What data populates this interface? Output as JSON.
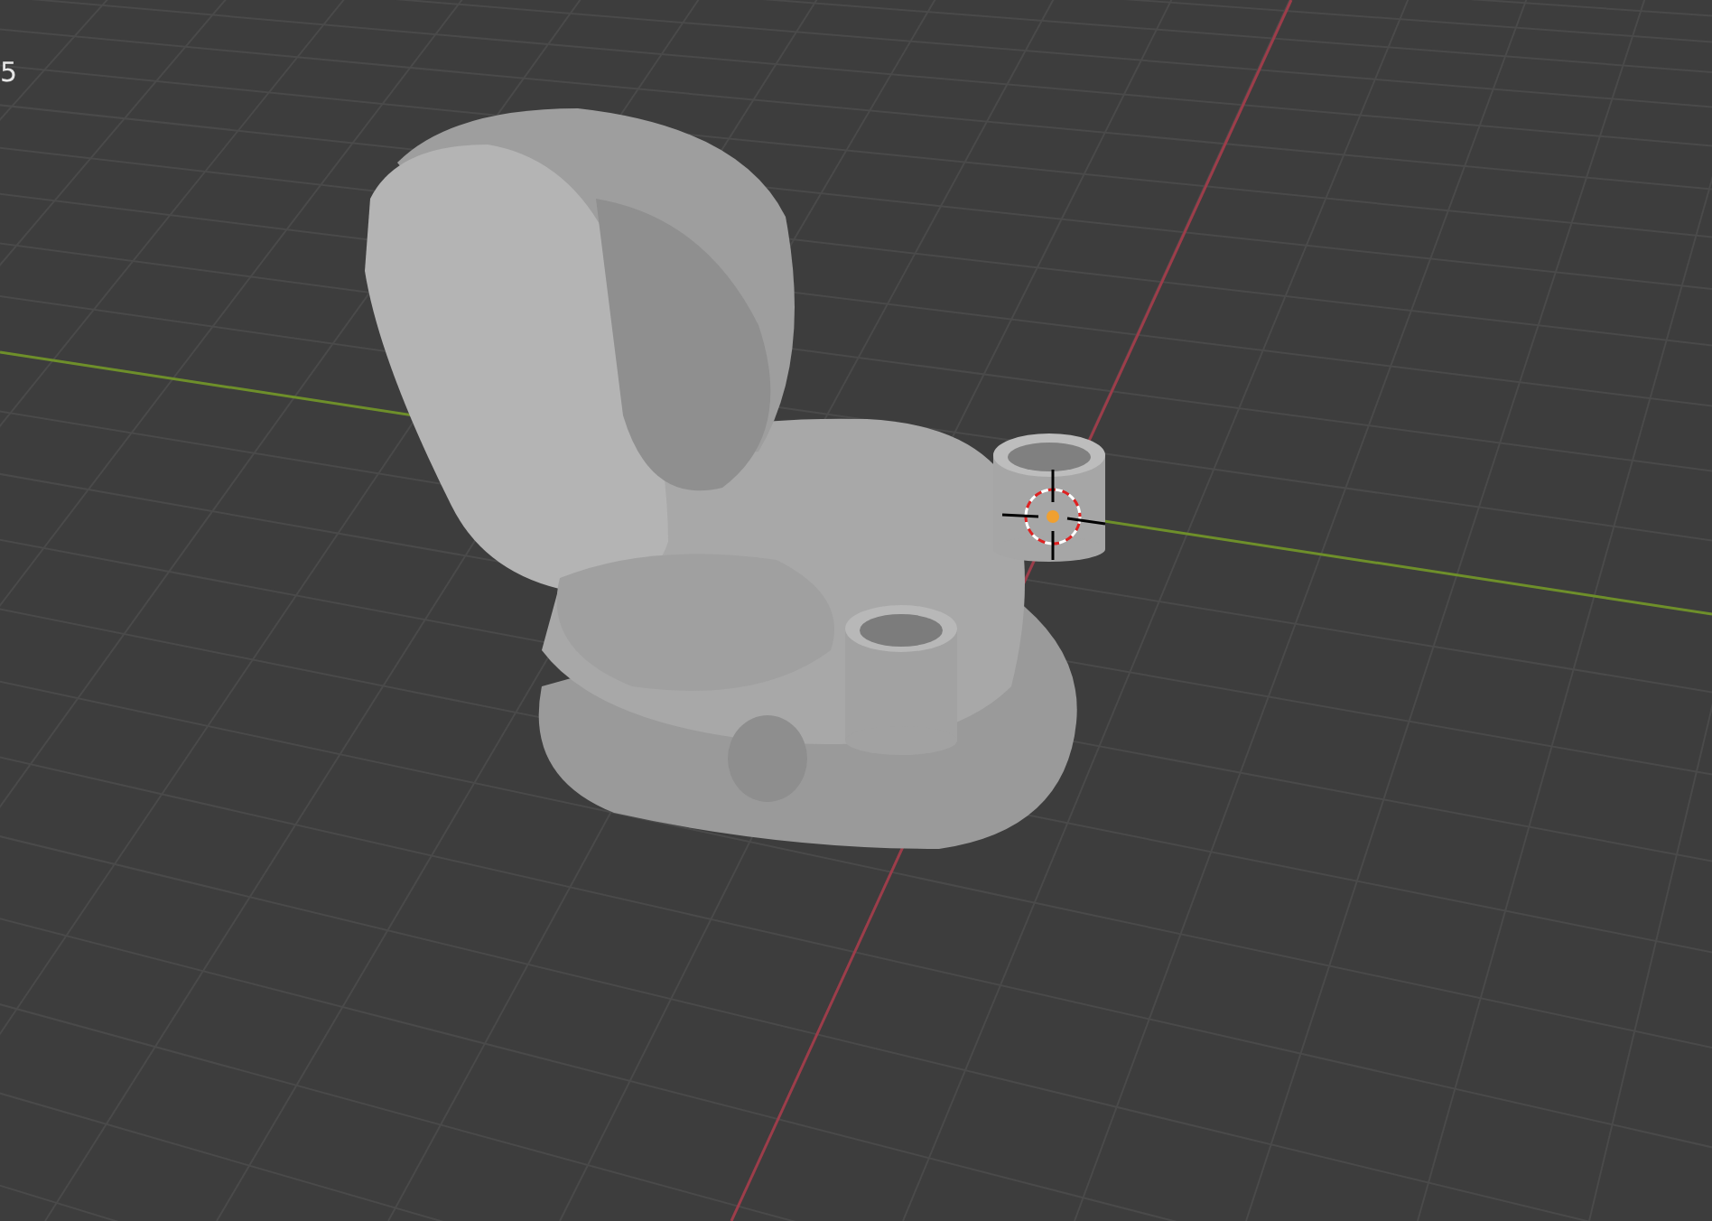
{
  "viewport": {
    "overlay_text": "5"
  }
}
